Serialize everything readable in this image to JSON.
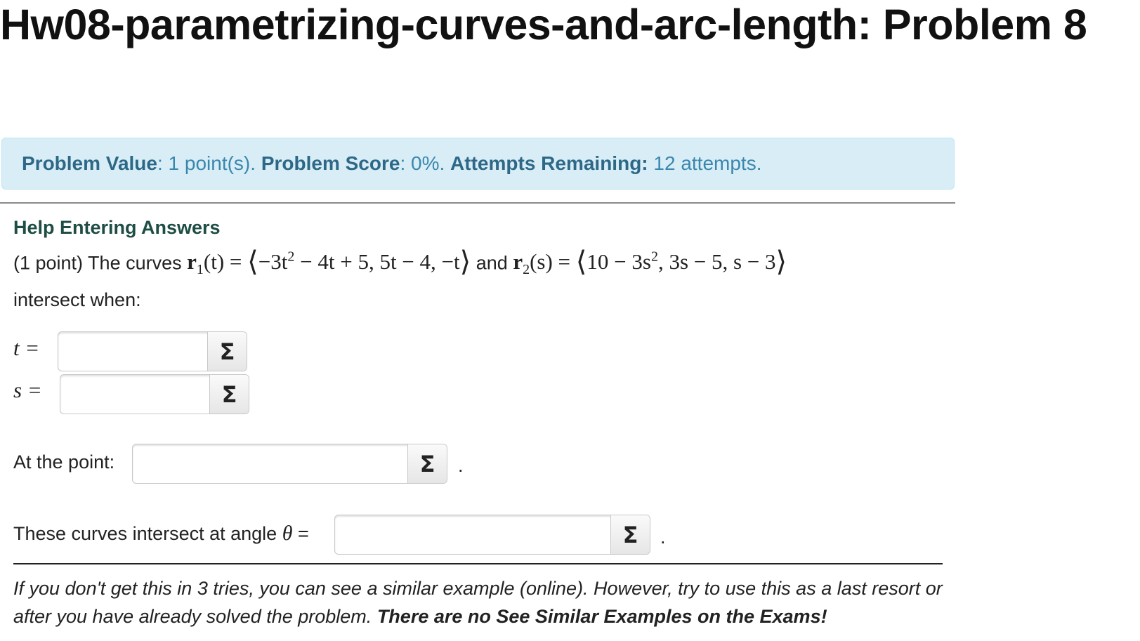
{
  "title": "Hw08-parametrizing-curves-and-arc-length: Problem 8",
  "status": {
    "value_label": "Problem Value",
    "value_text": ": 1 point(s). ",
    "score_label": "Problem Score",
    "score_text": ": 0%. ",
    "attempts_label": "Attempts Remaining:",
    "attempts_text": " 12 attempts."
  },
  "help_link": "Help Entering Answers",
  "problem": {
    "intro": "(1 point) The curves ",
    "r1_name": "r",
    "r1_sub": "1",
    "r1_arg": "(t) = ",
    "r1_vec_a": "−3t",
    "r1_vec_a_sup": "2",
    "r1_vec_b": " − 4t + 5, 5t − 4, −t",
    "conj": " and ",
    "r2_name": "r",
    "r2_sub": "2",
    "r2_arg": "(s) = ",
    "r2_vec_a": "10 − 3s",
    "r2_vec_a_sup": "2",
    "r2_vec_b": ", 3s − 5, s − 3",
    "langle": "⟨",
    "rangle": "⟩",
    "outro": "intersect when:"
  },
  "fields": {
    "t_label": "t =",
    "s_label": "s =",
    "point_label": "At the point:",
    "angle_label_prefix": "These curves intersect at angle ",
    "angle_symbol": "θ",
    "angle_label_suffix": " =",
    "sigma": "Σ",
    "period": ".",
    "t_value": "",
    "s_value": "",
    "point_value": "",
    "angle_value": ""
  },
  "footer": {
    "text": "If you don't get this in 3 tries, you can see a similar example (online). However, try to use this as a last resort or after you have already solved the problem. ",
    "bold": "There are no See Similar Examples on the Exams!"
  },
  "colors": {
    "alert_bg": "#d9edf7",
    "alert_text": "#3a87ad",
    "help_link": "#1d4d44"
  }
}
